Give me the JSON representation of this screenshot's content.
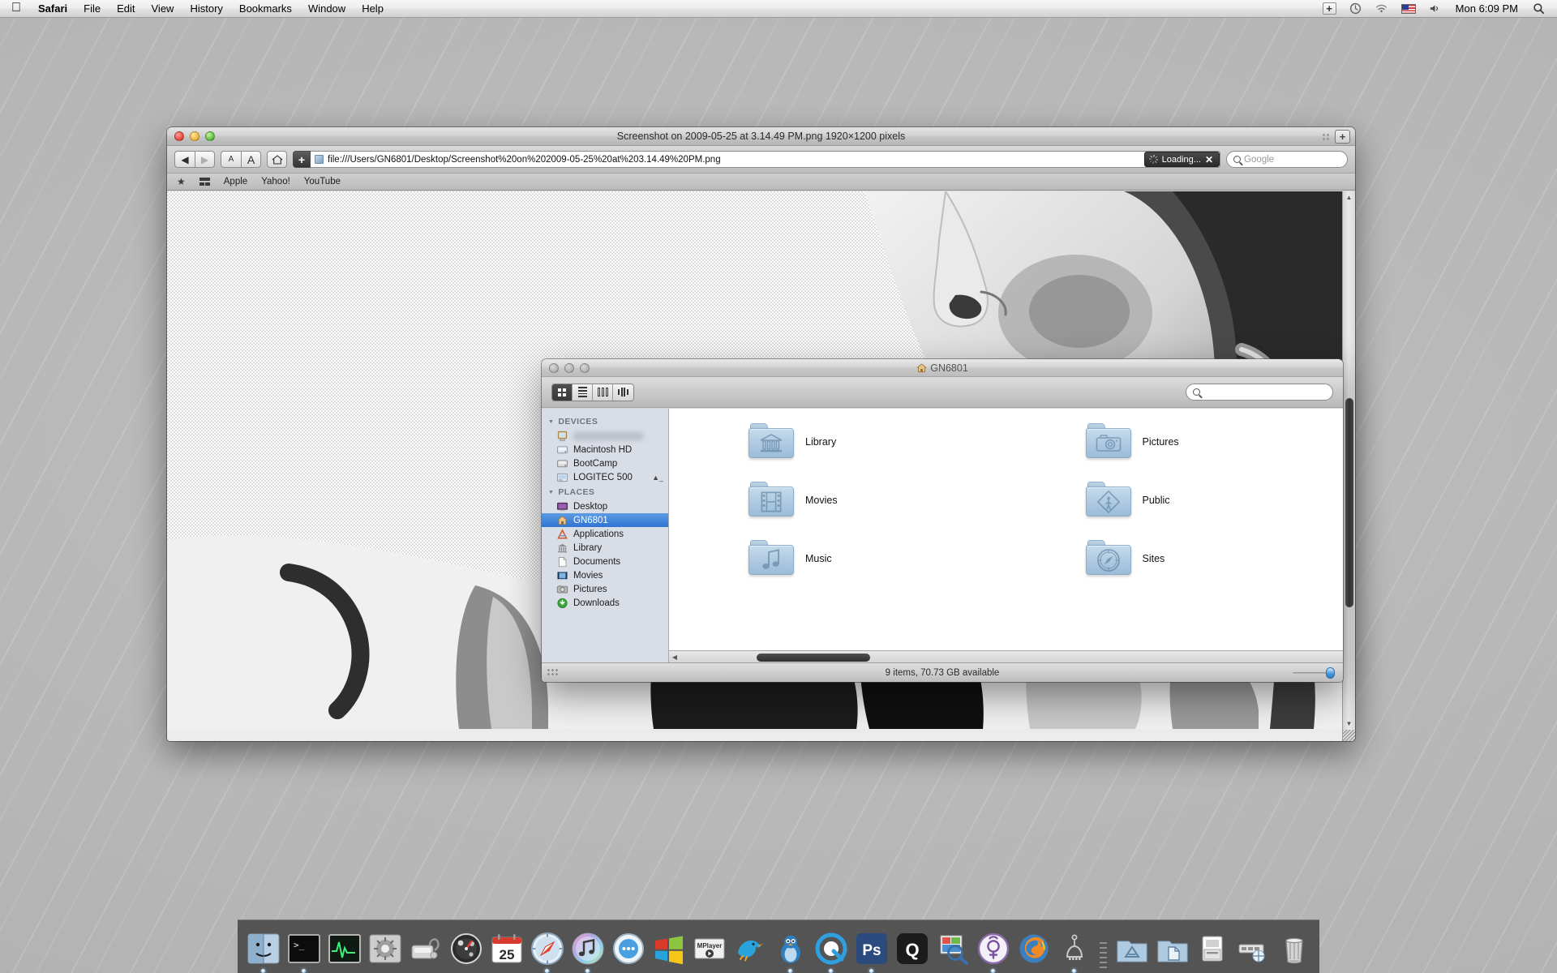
{
  "menubar": {
    "apple_glyph": "",
    "items": [
      {
        "label": "Safari",
        "bold": true
      },
      {
        "label": "File",
        "bold": false
      },
      {
        "label": "Edit",
        "bold": false
      },
      {
        "label": "View",
        "bold": false
      },
      {
        "label": "History",
        "bold": false
      },
      {
        "label": "Bookmarks",
        "bold": false
      },
      {
        "label": "Window",
        "bold": false
      },
      {
        "label": "Help",
        "bold": false
      }
    ],
    "status": {
      "plus_label": "+",
      "time_machine_icon": "time-machine-icon",
      "wifi_icon": "wifi-icon",
      "flag_icon": "us-flag-icon",
      "volume_icon": "volume-icon",
      "clock": "Mon 6:09 PM",
      "spotlight_icon": "spotlight-search-icon"
    }
  },
  "safari": {
    "title": "Screenshot on 2009-05-25 at 3.14.49 PM.png 1920×1200 pixels",
    "newtab_label": "+",
    "toolbar": {
      "back_label": "◀",
      "forward_label": "▶",
      "textsize_small_label": "A",
      "textsize_large_label": "A",
      "home_label": "⌂",
      "add_bookmark_label": "+",
      "url": "file:///Users/GN6801/Desktop/Screenshot%20on%202009-05-25%20at%203.14.49%20PM.png",
      "loading_label": "Loading...",
      "loading_stop_label": "✕",
      "search_placeholder": "Google"
    },
    "bookmarks_bar": {
      "show_all_label": "★",
      "top_sites_label": "top-sites-icon",
      "items": [
        "Apple",
        "Yahoo!",
        "YouTube"
      ]
    },
    "content": {
      "description": "Grayscale halftone illustration of a woman's face in profile (screenshot image being viewed)"
    }
  },
  "finder": {
    "title": "GN6801",
    "title_icon": "home-icon",
    "view_modes": [
      {
        "name": "icon-view",
        "selected": true
      },
      {
        "name": "list-view",
        "selected": false
      },
      {
        "name": "column-view",
        "selected": false
      },
      {
        "name": "coverflow-view",
        "selected": false
      }
    ],
    "search_placeholder": "",
    "sidebar": {
      "sections": [
        {
          "header": "DEVICES",
          "items": [
            {
              "label": "",
              "icon": "computer-icon",
              "redacted": true,
              "selected": false,
              "eject": false
            },
            {
              "label": "Macintosh HD",
              "icon": "harddisk-icon",
              "selected": false,
              "eject": false
            },
            {
              "label": "BootCamp",
              "icon": "harddisk-icon",
              "selected": false,
              "eject": false
            },
            {
              "label": "LOGITEC 500",
              "icon": "external-disk-icon",
              "selected": false,
              "eject": true
            }
          ]
        },
        {
          "header": "PLACES",
          "items": [
            {
              "label": "Desktop",
              "icon": "desktop-icon",
              "selected": false,
              "eject": false
            },
            {
              "label": "GN6801",
              "icon": "home-icon",
              "selected": true,
              "eject": false
            },
            {
              "label": "Applications",
              "icon": "applications-icon",
              "selected": false,
              "eject": false
            },
            {
              "label": "Library",
              "icon": "library-icon",
              "selected": false,
              "eject": false
            },
            {
              "label": "Documents",
              "icon": "documents-icon",
              "selected": false,
              "eject": false
            },
            {
              "label": "Movies",
              "icon": "movies-icon",
              "selected": false,
              "eject": false
            },
            {
              "label": "Pictures",
              "icon": "pictures-icon",
              "selected": false,
              "eject": false
            },
            {
              "label": "Downloads",
              "icon": "downloads-icon",
              "selected": false,
              "eject": false
            }
          ]
        }
      ]
    },
    "items": [
      {
        "label": "Library",
        "icon": "library-folder-icon"
      },
      {
        "label": "Pictures",
        "icon": "pictures-folder-icon"
      },
      {
        "label": "Movies",
        "icon": "movies-folder-icon"
      },
      {
        "label": "Public",
        "icon": "public-folder-icon"
      },
      {
        "label": "Music",
        "icon": "music-folder-icon"
      },
      {
        "label": "Sites",
        "icon": "sites-folder-icon"
      }
    ],
    "status": "9 items, 70.73 GB available"
  },
  "dock": {
    "items": [
      {
        "name": "finder",
        "label": "Finder",
        "running": true
      },
      {
        "name": "terminal",
        "label": "Terminal",
        "running": true
      },
      {
        "name": "activity-monitor",
        "label": "Activity Monitor",
        "running": false
      },
      {
        "name": "system-preferences",
        "label": "System Preferences",
        "running": false
      },
      {
        "name": "disk-utility",
        "label": "Disk Utility",
        "running": false
      },
      {
        "name": "dashboard",
        "label": "Dashboard",
        "running": false
      },
      {
        "name": "ical",
        "label": "iCal",
        "running": false
      },
      {
        "name": "safari",
        "label": "Safari",
        "running": true
      },
      {
        "name": "itunes",
        "label": "iTunes",
        "running": true
      },
      {
        "name": "adium",
        "label": "Adium",
        "running": false
      },
      {
        "name": "windows-vm",
        "label": "Windows",
        "running": false
      },
      {
        "name": "mplayer",
        "label": "MPlayer",
        "running": false
      },
      {
        "name": "twitter-bird",
        "label": "Twitterrific",
        "running": false
      },
      {
        "name": "penguin-app",
        "label": "Penguin",
        "running": true
      },
      {
        "name": "quicktime",
        "label": "QuickTime",
        "running": true
      },
      {
        "name": "photoshop",
        "label": "Photoshop",
        "running": true
      },
      {
        "name": "quicksilver",
        "label": "Quicksilver",
        "running": false
      },
      {
        "name": "preview",
        "label": "Preview",
        "running": false
      },
      {
        "name": "mercury-app",
        "label": "Mercury",
        "running": true
      },
      {
        "name": "firefox",
        "label": "Firefox",
        "running": false
      },
      {
        "name": "transmission",
        "label": "Transmission",
        "running": true
      }
    ],
    "right_items": [
      {
        "name": "applications-stack",
        "label": "Applications"
      },
      {
        "name": "documents-stack",
        "label": "Documents"
      },
      {
        "name": "downloads-stack",
        "label": "Downloads"
      },
      {
        "name": "widget-stack",
        "label": "Widgets"
      },
      {
        "name": "trash",
        "label": "Trash"
      }
    ],
    "ical_day": "25",
    "ical_month": "MAY",
    "mplayer_label": "MPlayer",
    "photoshop_label": "Ps",
    "quicksilver_label": "Q"
  },
  "colors": {
    "selection_blue": "#2f74d0",
    "folder_blue": "#aec9e1",
    "dock_bg": "#3e3e3e",
    "menubar_bg": "#ededed",
    "desktop_gray": "#b4b4b4"
  }
}
